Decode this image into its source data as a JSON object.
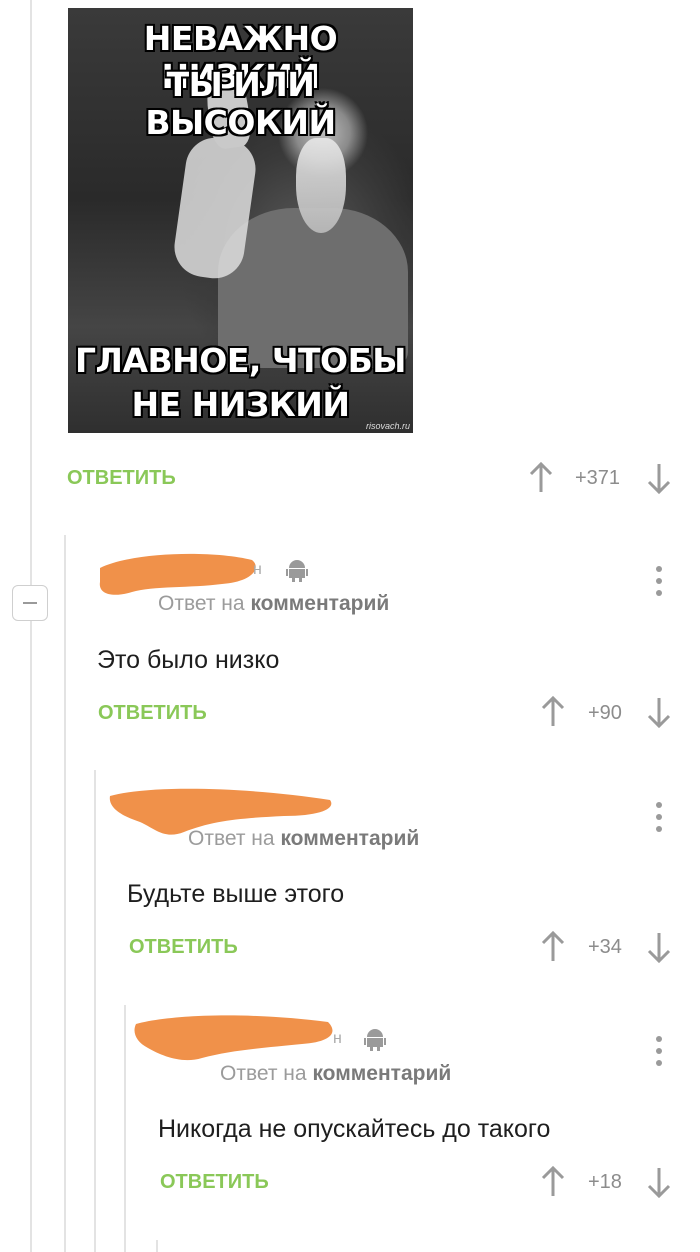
{
  "meme": {
    "top_line1": "НЕВАЖНО НИЗКИЙ",
    "top_line2": "ТЫ ИЛИ ВЫСОКИЙ",
    "bottom_line1": "ГЛАВНОЕ, ЧТОБЫ",
    "bottom_line2": "НЕ НИЗКИЙ",
    "watermark": "risovach.ru"
  },
  "post_actions": {
    "reply_label": "ОТВЕТИТЬ",
    "score": "+371"
  },
  "comments": [
    {
      "reply_to": "Ответ на",
      "reply_target": "комментарий",
      "text": "Это было низко",
      "reply_label": "ОТВЕТИТЬ",
      "score": "+90",
      "author_initial": "н"
    },
    {
      "reply_to": "Ответ на",
      "reply_target": "комментарий",
      "text": "Будьте выше этого",
      "reply_label": "ОТВЕТИТЬ",
      "score": "+34"
    },
    {
      "reply_to": "Ответ на",
      "reply_target": "комментарий",
      "text": "Никогда не опускайтесь до такого",
      "reply_label": "ОТВЕТИТЬ",
      "score": "+18",
      "author_initial": "н"
    }
  ],
  "colors": {
    "accent": "#8ac858",
    "muted": "#8c8c8c",
    "redaction": "#f0914a"
  },
  "icons": [
    "arrow-up-icon",
    "arrow-down-icon",
    "more-icon",
    "android-icon",
    "collapse-icon"
  ]
}
